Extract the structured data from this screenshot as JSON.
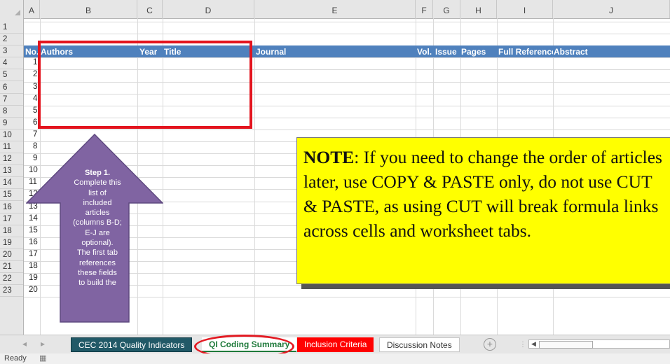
{
  "columns": [
    "A",
    "B",
    "C",
    "D",
    "E",
    "F",
    "G",
    "H",
    "I",
    "J"
  ],
  "rows": [
    "1",
    "2",
    "3",
    "4",
    "5",
    "6",
    "7",
    "8",
    "9",
    "10",
    "11",
    "12",
    "13",
    "14",
    "15",
    "16",
    "17",
    "18",
    "19",
    "20",
    "21",
    "22",
    "23"
  ],
  "header_row": {
    "no": "No.",
    "authors": "Authors",
    "year": "Year",
    "title": "Title",
    "journal": "Journal",
    "vol": "Vol.",
    "issue": "Issue",
    "pages": "Pages",
    "full_ref": "Full Reference",
    "abstract": "Abstract"
  },
  "numbers": [
    "1",
    "2",
    "3",
    "4",
    "5",
    "6",
    "7",
    "8",
    "9",
    "10",
    "11",
    "12",
    "13",
    "14",
    "15",
    "16",
    "17",
    "18",
    "19",
    "20"
  ],
  "step": {
    "title": "Step 1.",
    "lines": [
      "Complete this",
      "list of",
      "included",
      "articles",
      "(columns B-D;",
      "E-J are",
      "optional).",
      "The first tab",
      "references",
      "these fields",
      "to build the"
    ]
  },
  "note": {
    "label": "NOTE",
    "text": ": If you need to change the order of articles later, use COPY & PASTE only, do not use CUT & PASTE, as using CUT will break formula links across cells and worksheet tabs."
  },
  "tabs": {
    "tab1": "CEC 2014 Quality Indicators",
    "tab2": "QI Coding Summary",
    "tab3": "Inclusion Criteria",
    "tab4": "Discussion Notes"
  },
  "status": {
    "ready": "Ready"
  },
  "colors": {
    "header_blue": "#4f81bd",
    "note_yellow": "#ffff00",
    "highlight_red": "#e3141e",
    "arrow_purple": "#8064a2"
  }
}
